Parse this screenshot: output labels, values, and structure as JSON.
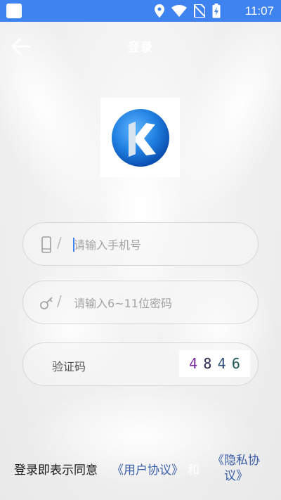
{
  "status_bar": {
    "time": "11:07",
    "icons": [
      "app-badge",
      "location-icon",
      "wifi-icon",
      "no-sim-icon",
      "battery-charging-icon"
    ]
  },
  "header": {
    "title": "登录",
    "back_icon": "arrow-left-icon"
  },
  "logo": {
    "letter": "K"
  },
  "form": {
    "phone": {
      "placeholder": "请输入手机号",
      "value": "",
      "icon": "phone-icon"
    },
    "password": {
      "placeholder": "请输入6~11位密码",
      "value": "",
      "icon": "key-icon"
    },
    "captcha": {
      "label": "验证码",
      "digits": [
        {
          "char": "4",
          "color": "#7a2e9c"
        },
        {
          "char": "8",
          "color": "#2b2b55"
        },
        {
          "char": "4",
          "color": "#2f4f7a"
        },
        {
          "char": "6",
          "color": "#1e5a57"
        }
      ]
    },
    "slash": "/"
  },
  "agreement": {
    "prefix": "登录即表示同意",
    "user_agreement": "《用户协议》",
    "and": "和",
    "privacy_policy": "《隐私协议》"
  },
  "colors": {
    "status_bar": "#3f83f0",
    "link": "#3a5fa8",
    "placeholder": "#a3a3a3"
  }
}
